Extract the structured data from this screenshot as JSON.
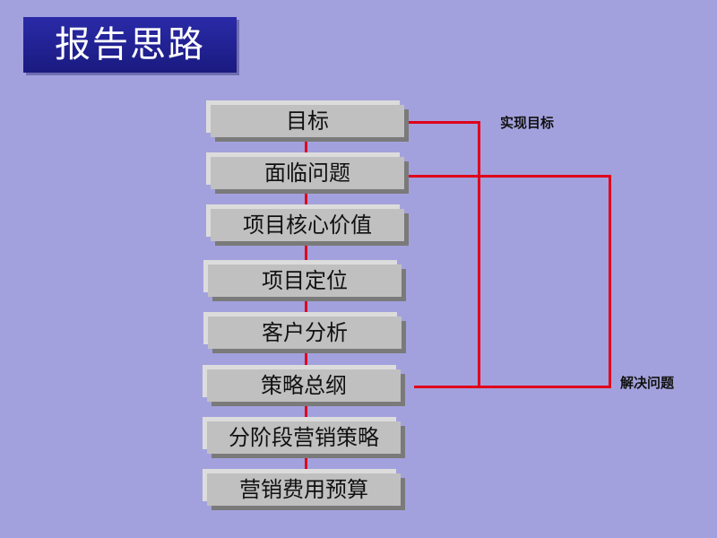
{
  "title": "报告思路",
  "steps": [
    {
      "label": "目标"
    },
    {
      "label": "面临问题"
    },
    {
      "label": "项目核心价值"
    },
    {
      "label": "项目定位"
    },
    {
      "label": "客户分析"
    },
    {
      "label": "策略总纲"
    },
    {
      "label": "分阶段营销策略"
    },
    {
      "label": "营销费用预算"
    }
  ],
  "annotations": {
    "achieve_goal": "实现目标",
    "solve_problem": "解决问题"
  },
  "colors": {
    "connector": "#e0001a",
    "title_bg": "#1f1f90",
    "background": "#a3a1dd"
  }
}
